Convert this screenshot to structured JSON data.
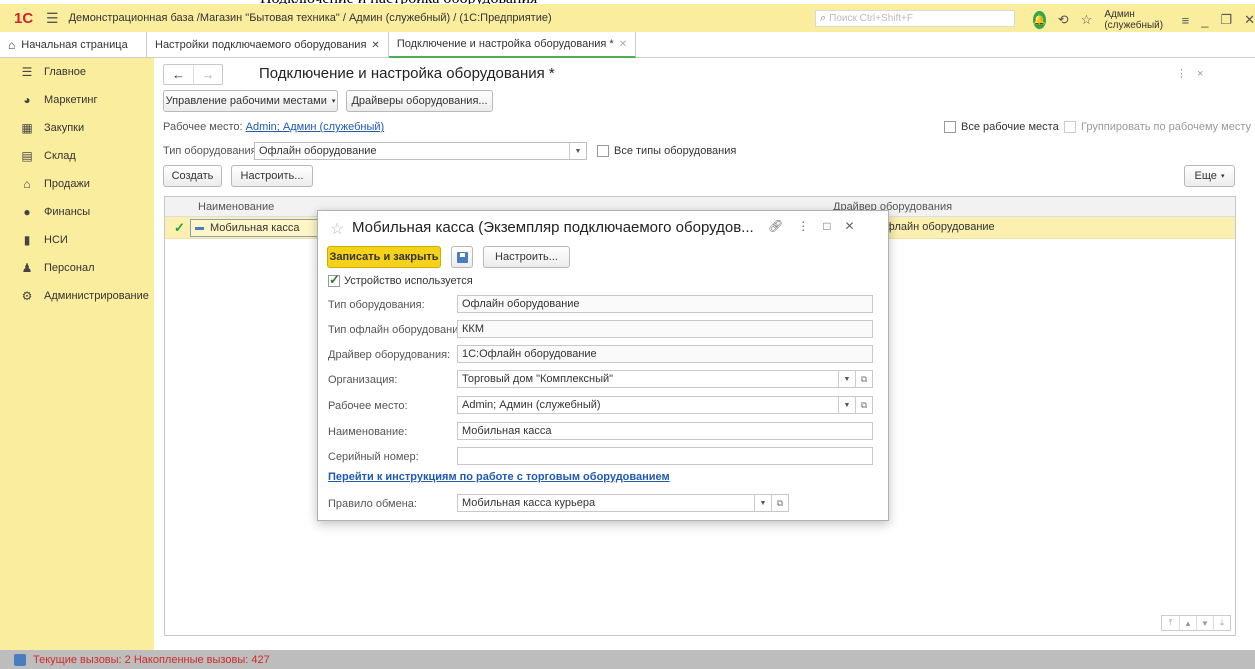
{
  "app": {
    "logo": "1С",
    "title": "Демонстрационная база /Магазин \"Бытовая техника\" / Админ (служебный) / (1С:Предприятие)",
    "search_placeholder": "Поиск Ctrl+Shift+F",
    "user": "Админ (служебный)"
  },
  "tabs": [
    {
      "label": "Начальная страница"
    },
    {
      "label": "Настройки подключаемого оборудования"
    },
    {
      "label": "Подключение и настройка оборудования *"
    }
  ],
  "sidebar": {
    "items": [
      {
        "label": "Главное",
        "icon": "list-icon"
      },
      {
        "label": "Маркетинг",
        "icon": "chart-icon"
      },
      {
        "label": "Закупки",
        "icon": "cart-icon"
      },
      {
        "label": "Склад",
        "icon": "warehouse-icon"
      },
      {
        "label": "Продажи",
        "icon": "shop-icon"
      },
      {
        "label": "Финансы",
        "icon": "coin-icon"
      },
      {
        "label": "НСИ",
        "icon": "book-icon"
      },
      {
        "label": "Персонал",
        "icon": "person-icon"
      },
      {
        "label": "Администрирование",
        "icon": "gear-icon"
      }
    ]
  },
  "main": {
    "title": "Подключение и настройка оборудования *",
    "manage_workplaces": "Управление рабочими местами",
    "drivers": "Драйверы оборудования...",
    "workplace_label": "Рабочее место:",
    "workplace_value": "Admin; Админ (служебный)",
    "all_workplaces": "Все рабочие места",
    "group_by_workplace": "Группировать по рабочему месту",
    "type_label": "Тип оборудования:",
    "type_value": "Офлайн оборудование",
    "all_types": "Все типы оборудования",
    "create": "Создать",
    "configure": "Настроить...",
    "more": "Еще",
    "columns": [
      "Наименование",
      "Драйвер оборудования"
    ],
    "rows": [
      {
        "name": "Мобильная касса",
        "driver": "1С:Офлайн оборудование"
      }
    ]
  },
  "dialog": {
    "title": "Мобильная касса (Экземпляр подключаемого оборудов...",
    "save_close": "Записать и закрыть",
    "configure": "Настроить...",
    "device_used": "Устройство используется",
    "fields": {
      "equipment_type_label": "Тип оборудования:",
      "equipment_type": "Офлайн оборудование",
      "offline_type_label": "Тип офлайн оборудования:",
      "offline_type": "ККМ",
      "driver_label": "Драйвер оборудования:",
      "driver": "1С:Офлайн оборудование",
      "org_label": "Организация:",
      "org": "Торговый дом \"Комплексный\"",
      "workplace_label": "Рабочее место:",
      "workplace": "Admin; Админ (служебный)",
      "name_label": "Наименование:",
      "name": "Мобильная касса",
      "serial_label": "Серийный номер:",
      "serial": ""
    },
    "instructions_link": "Перейти к инструкциям по работе с торговым оборудованием",
    "exchange_rule_label": "Правило обмена:",
    "exchange_rule": "Мобильная касса курьера"
  },
  "status": {
    "text": "Текущие вызовы: 2   Накопленные вызовы: 427"
  }
}
